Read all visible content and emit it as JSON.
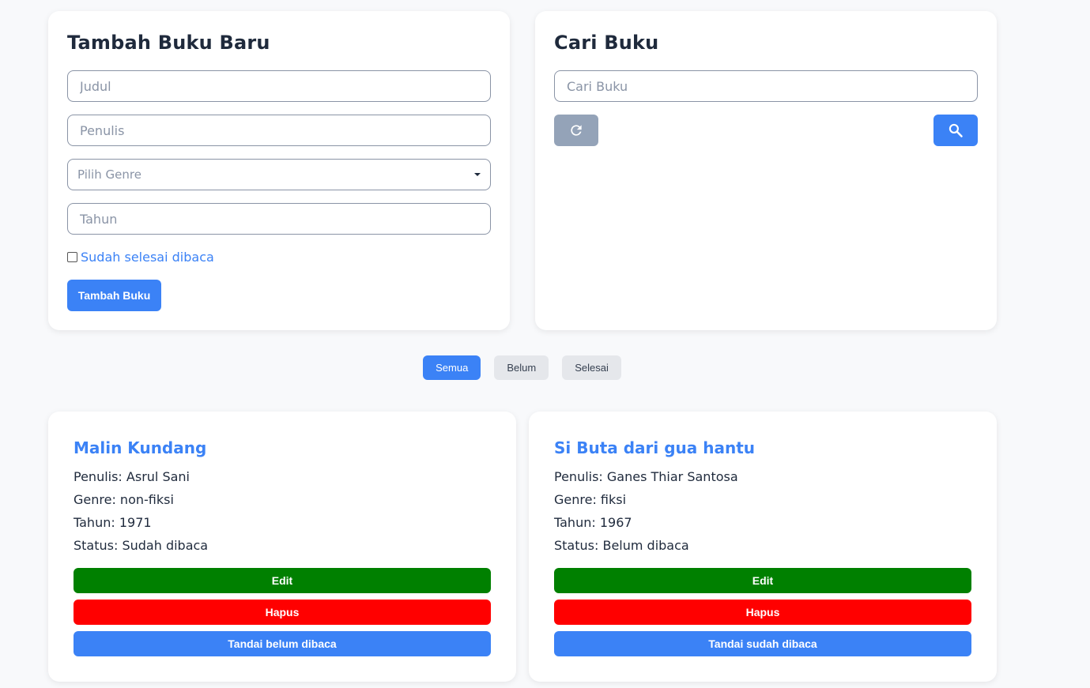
{
  "add_form": {
    "title": "Tambah Buku Baru",
    "judul_placeholder": "Judul",
    "penulis_placeholder": "Penulis",
    "genre_placeholder": "Pilih Genre",
    "tahun_placeholder": "Tahun",
    "finished_label": "Sudah selesai dibaca",
    "submit_label": "Tambah Buku"
  },
  "search": {
    "title": "Cari Buku",
    "placeholder": "Cari Buku",
    "reset_icon": "refresh-icon",
    "search_icon": "search-icon"
  },
  "filters": [
    {
      "label": "Semua",
      "active": true
    },
    {
      "label": "Belum",
      "active": false
    },
    {
      "label": "Selesai",
      "active": false
    }
  ],
  "books": [
    {
      "title": "Malin Kundang",
      "author_line": "Penulis: Asrul Sani",
      "genre_line": "Genre: non-fiksi",
      "year_line": "Tahun: 1971",
      "status_line": "Status: Sudah dibaca",
      "edit_label": "Edit",
      "delete_label": "Hapus",
      "toggle_label": "Tandai belum dibaca"
    },
    {
      "title": "Si Buta dari gua hantu",
      "author_line": "Penulis: Ganes Thiar Santosa",
      "genre_line": "Genre: fiksi",
      "year_line": "Tahun: 1967",
      "status_line": "Status: Belum dibaca",
      "edit_label": "Edit",
      "delete_label": "Hapus",
      "toggle_label": "Tandai sudah dibaca"
    }
  ],
  "colors": {
    "accent": "#3b82f6",
    "edit": "#008000",
    "delete": "#ff0000",
    "reset": "#94a3b8"
  }
}
